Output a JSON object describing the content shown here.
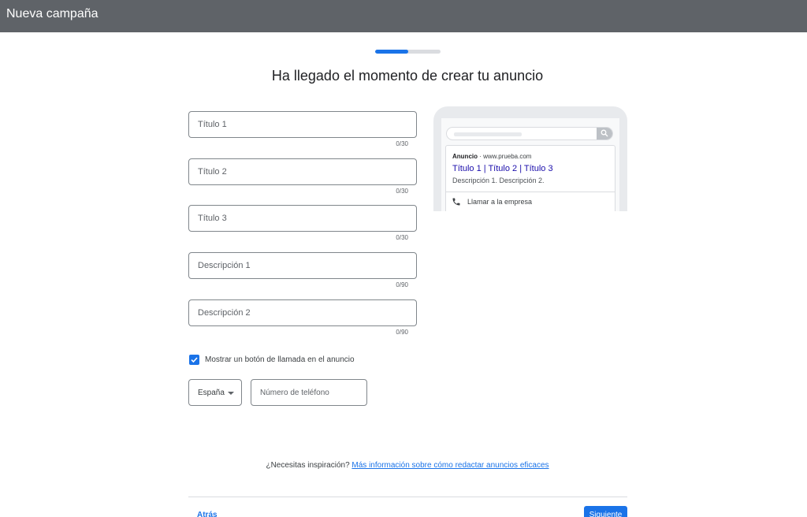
{
  "header": {
    "title": "Nueva campaña"
  },
  "progress": {
    "value": 0.5
  },
  "page": {
    "heading": "Ha llegado el momento de crear tu anuncio"
  },
  "form": {
    "fields": [
      {
        "placeholder": "Título 1",
        "value": "",
        "counter": "0/30"
      },
      {
        "placeholder": "Título 2",
        "value": "",
        "counter": "0/30"
      },
      {
        "placeholder": "Título 3",
        "value": "",
        "counter": "0/30"
      },
      {
        "placeholder": "Descripción 1",
        "value": "",
        "counter": "0/90"
      },
      {
        "placeholder": "Descripción 2",
        "value": "",
        "counter": "0/90"
      }
    ],
    "call_checkbox": {
      "label": "Mostrar un botón de llamada en el anuncio",
      "checked": true
    },
    "country": {
      "selected": "España"
    },
    "phone": {
      "placeholder": "Número de teléfono",
      "value": ""
    }
  },
  "preview": {
    "ad_label": "Anuncio",
    "url": " · www.prueba.com",
    "title": "Título 1 | Título 2 | Título 3",
    "description": "Descripción 1. Descripción 2.",
    "call_label": "Llamar a la empresa"
  },
  "inspiration": {
    "prompt": "¿Necesitas inspiración? ",
    "link": "Más información sobre cómo redactar anuncios eficaces"
  },
  "footer": {
    "back_label": "Atrás",
    "next_label": "Siguiente"
  },
  "colors": {
    "accent": "#1a73e8",
    "header_bg": "#5f6368",
    "ad_title": "#1a0dab"
  },
  "icons": {
    "search": "search-icon",
    "phone": "phone-icon",
    "check": "check-icon",
    "dropdown": "chevron-down-icon"
  }
}
